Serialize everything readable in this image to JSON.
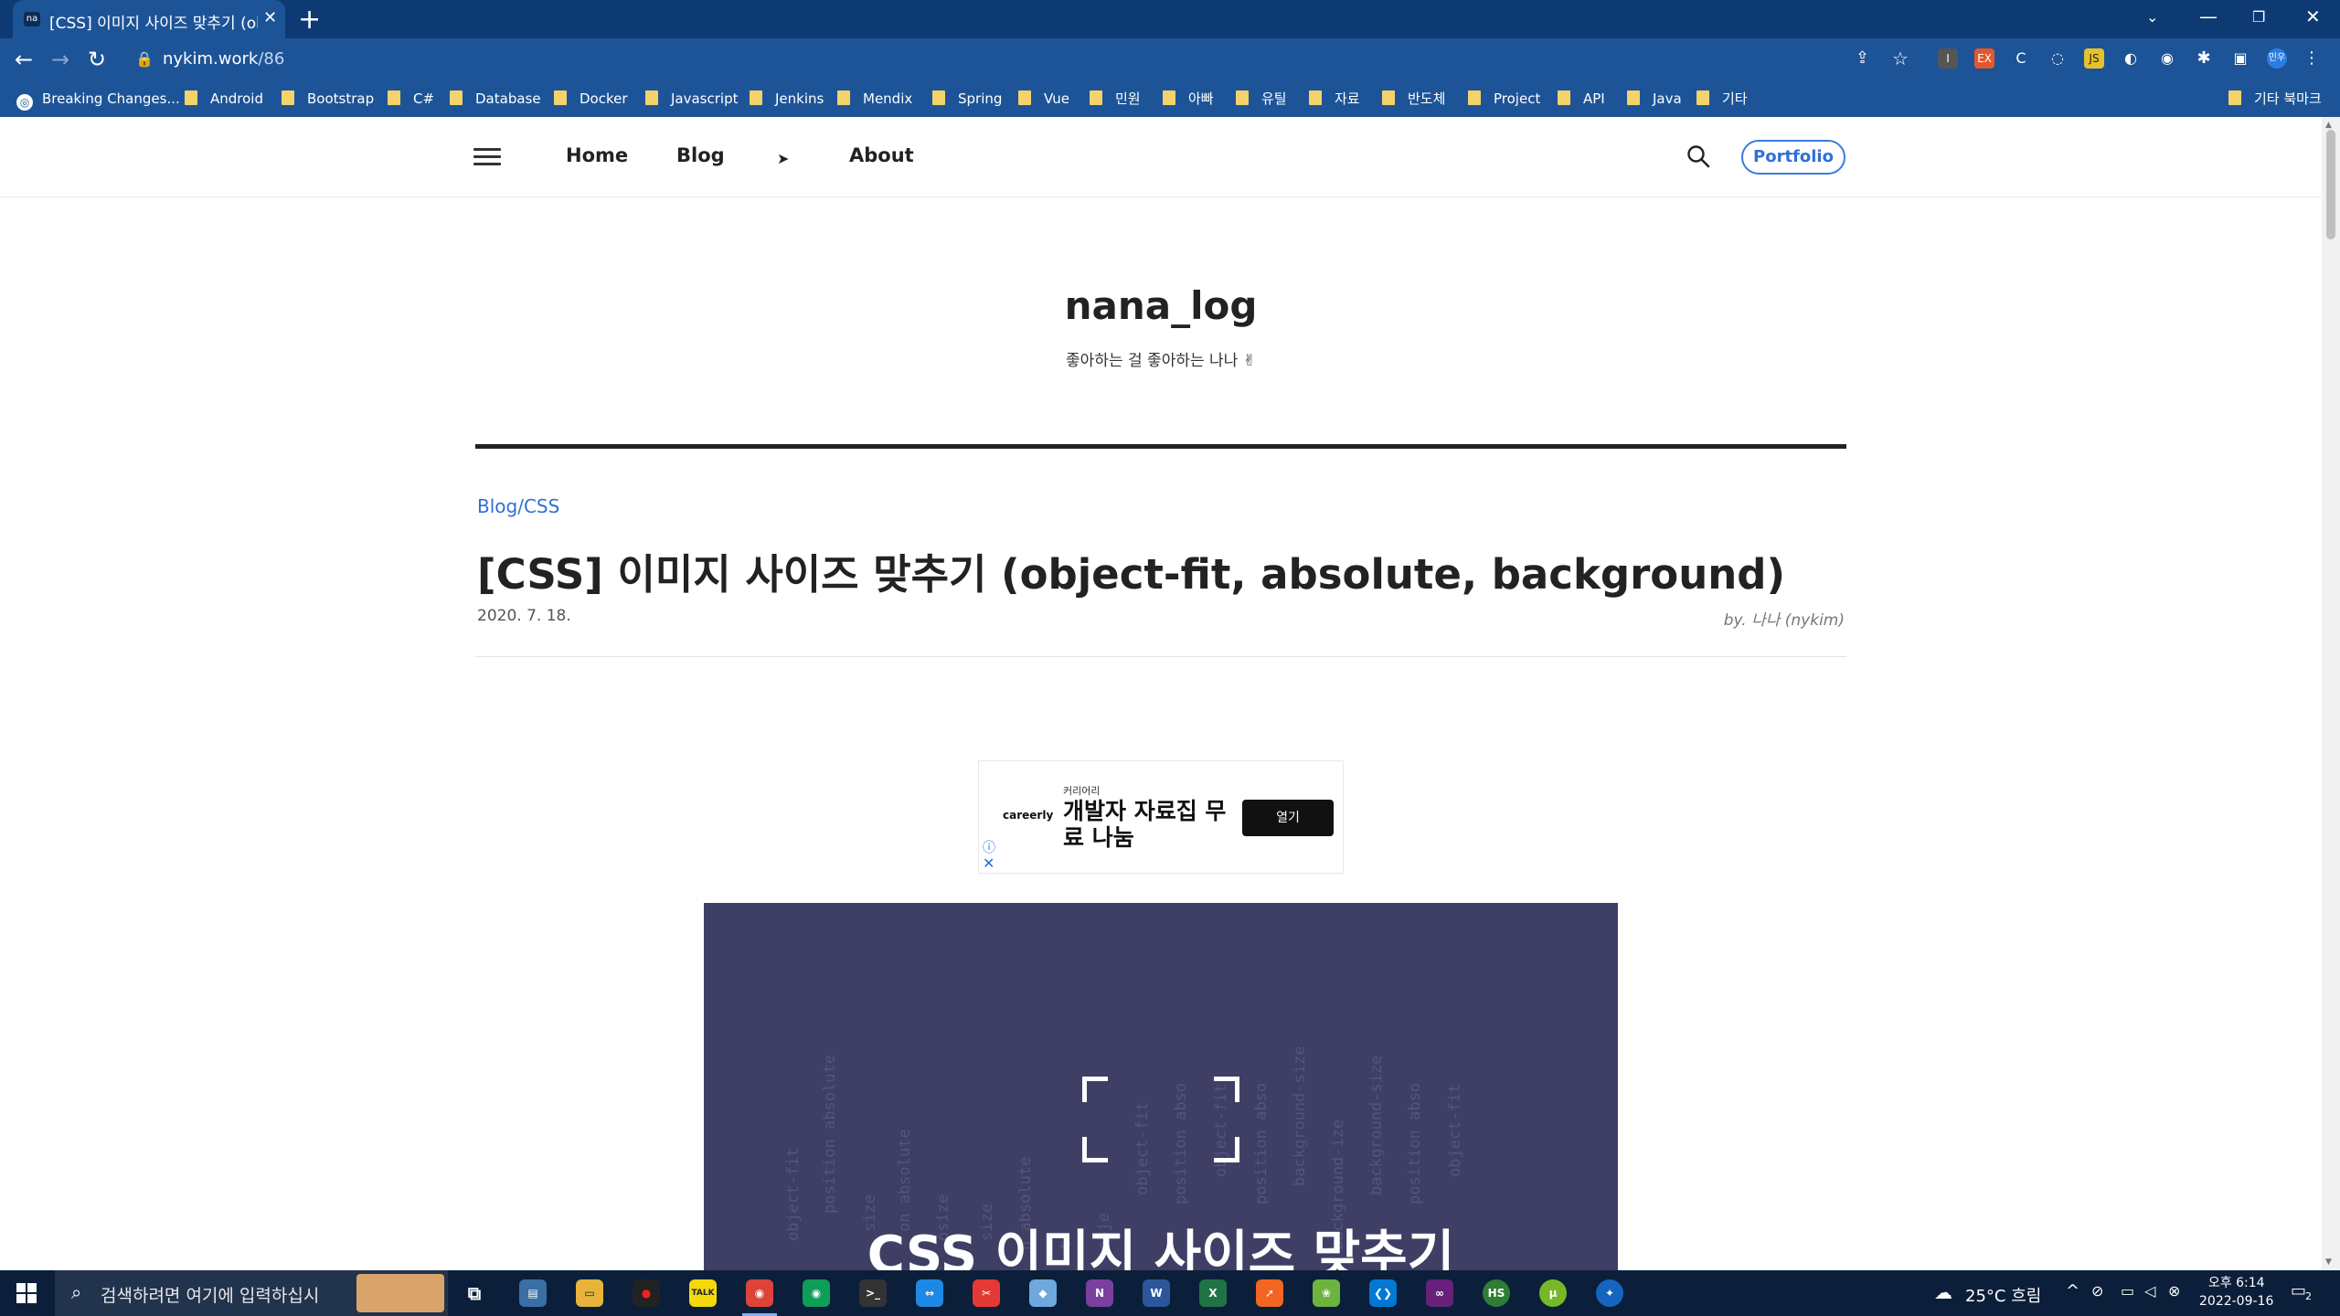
{
  "browser": {
    "tab_title": "[CSS] 이미지 사이즈 맞추기 (obj",
    "tab_favicon": "na",
    "url_host": "nykim.work",
    "url_path": "/86",
    "bookmarks": [
      "Breaking Changes...",
      "Android",
      "Bootstrap",
      "C#",
      "Database",
      "Docker",
      "Javascript",
      "Jenkins",
      "Mendix",
      "Spring",
      "Vue",
      "민원",
      "아빠",
      "유틸",
      "자료",
      "반도체",
      "Project",
      "API",
      "Java",
      "기타"
    ],
    "other_bookmarks": "기타 북마크",
    "profile_badge": "민우"
  },
  "site": {
    "nav": {
      "home": "Home",
      "blog": "Blog",
      "about": "About"
    },
    "portfolio_label": "Portfolio",
    "blog_title": "nana_log",
    "blog_subtitle": "좋아하는 걸 좋아하는 나나 ✌"
  },
  "post": {
    "category": "Blog/CSS",
    "title": "[CSS] 이미지 사이즈 맞추기 (object-fit, absolute, background)",
    "date": "2020. 7. 18.",
    "author": "by. 나나 (nykim)"
  },
  "ad": {
    "brand": "careerly",
    "small_text": "커리어리",
    "headline": "개발자 자료집 무료 나눔",
    "cta": "열기"
  },
  "hero": {
    "overlay_text": "CSS 이미지 사이즈 맞추기",
    "background_words": [
      "object-fit",
      "position absolute",
      "size",
      "on absolute",
      "osize",
      "size",
      "n absolute",
      "t",
      "obje",
      "object-fit",
      "position abso",
      "object-fit",
      "position abso",
      "background-size",
      "background-ize",
      "background-size",
      "position abso",
      "object-fit"
    ]
  },
  "taskbar": {
    "search_placeholder": "검색하려면 여기에 입력하십시",
    "weather": "25°C  흐림",
    "time": "오후 6:14",
    "date": "2022-09-16",
    "notification_count": "2"
  },
  "colors": {
    "browser_dark": "#0d3a72",
    "browser": "#1d5498",
    "accent": "#2f6fd8",
    "hero_bg": "#3f3f66"
  }
}
